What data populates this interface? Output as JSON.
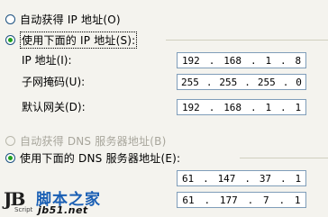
{
  "ip_section": {
    "auto_option": "自动获得 IP 地址(O)",
    "manual_option": "使用下面的 IP 地址(S):",
    "fields": [
      {
        "label": "IP 地址(I):",
        "octets": [
          "192",
          "168",
          "1",
          "8"
        ]
      },
      {
        "label": "子网掩码(U):",
        "octets": [
          "255",
          "255",
          "255",
          "0"
        ]
      },
      {
        "label": "默认网关(D):",
        "octets": [
          "192",
          "168",
          "1",
          "1"
        ]
      }
    ]
  },
  "dns_section": {
    "auto_option": "自动获得 DNS 服务器地址(B)",
    "manual_option": "使用下面的 DNS 服务器地址(E):",
    "fields": [
      {
        "octets": [
          "61",
          "147",
          "37",
          "1"
        ]
      },
      {
        "octets": [
          "61",
          "177",
          "7",
          "1"
        ]
      }
    ]
  },
  "watermark": {
    "jb": "JB",
    "script": "Script",
    "site_name": "脚本之家",
    "url": "jb51.net"
  }
}
